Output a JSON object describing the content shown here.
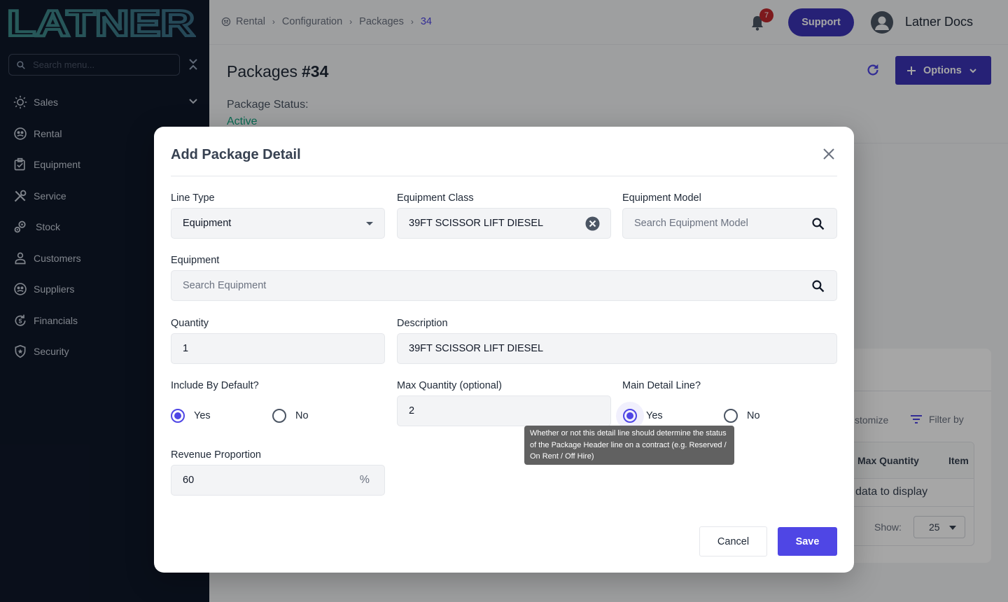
{
  "sidebar": {
    "logo_text": "LATNER",
    "search_placeholder": "Search menu...",
    "items": [
      {
        "label": "Sales",
        "icon": "sales-icon"
      },
      {
        "label": "Rental",
        "icon": "rental-icon"
      },
      {
        "label": "Equipment",
        "icon": "equipment-icon"
      },
      {
        "label": "Service",
        "icon": "service-icon"
      },
      {
        "label": "Stock",
        "icon": "stock-icon"
      },
      {
        "label": "Customers",
        "icon": "customers-icon"
      },
      {
        "label": "Suppliers",
        "icon": "suppliers-icon"
      },
      {
        "label": "Financials",
        "icon": "financials-icon"
      },
      {
        "label": "Security",
        "icon": "security-icon"
      }
    ]
  },
  "topbar": {
    "breadcrumb": [
      "Rental",
      "Configuration",
      "Packages",
      "34"
    ],
    "notification_count": "7",
    "support_label": "Support",
    "user_name": "Latner Docs"
  },
  "page": {
    "title": "Packages",
    "id": "#34",
    "options_label": "Options",
    "status_label": "Package Status:",
    "status_value": "Active"
  },
  "background_table": {
    "customize_label": "stomize",
    "filter_label": "Filter by",
    "columns": [
      "Max Quantity",
      "Item"
    ],
    "empty_text": "data to display",
    "show_label": "Show:",
    "page_size": "25"
  },
  "modal": {
    "title": "Add Package Detail",
    "line_type": {
      "label": "Line Type",
      "value": "Equipment"
    },
    "equipment_class": {
      "label": "Equipment Class",
      "value": "39FT SCISSOR LIFT DIESEL"
    },
    "equipment_model": {
      "label": "Equipment Model",
      "placeholder": "Search Equipment Model"
    },
    "equipment": {
      "label": "Equipment",
      "placeholder": "Search Equipment"
    },
    "quantity": {
      "label": "Quantity",
      "value": "1"
    },
    "description": {
      "label": "Description",
      "value": "39FT SCISSOR LIFT DIESEL"
    },
    "include_by_default": {
      "label": "Include By Default?",
      "yes": "Yes",
      "no": "No",
      "selected": "Yes"
    },
    "max_quantity": {
      "label": "Max Quantity (optional)",
      "value": "2"
    },
    "main_detail_line": {
      "label": "Main Detail Line?",
      "yes": "Yes",
      "no": "No",
      "selected": "Yes"
    },
    "tooltip": "Whether or not this detail line should determine the status of the Package Header line on a contract (e.g. Reserved / On Rent / Off Hire)",
    "revenue_proportion": {
      "label": "Revenue Proportion",
      "value": "60",
      "unit": "%"
    },
    "cancel_label": "Cancel",
    "save_label": "Save"
  },
  "colors": {
    "sidebar_bg": "#0f1729",
    "accent": "#4f46e5",
    "support_bg": "#3b34b5",
    "status_active": "#10a37f",
    "badge": "#c0282d"
  }
}
